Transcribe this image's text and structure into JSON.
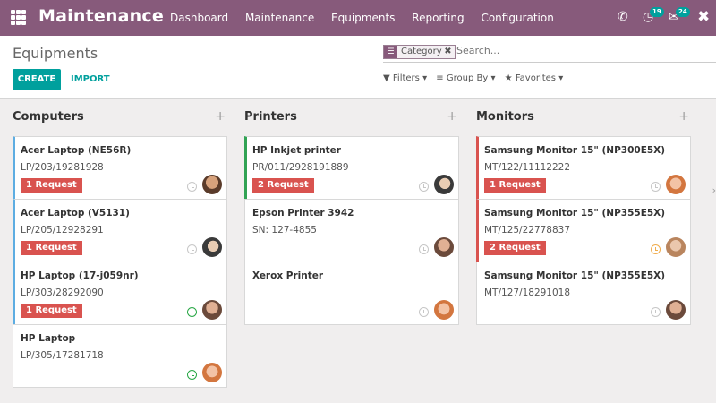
{
  "app": {
    "title": "Maintenance",
    "nav": [
      "Dashboard",
      "Maintenance",
      "Equipments",
      "Reporting",
      "Configuration"
    ],
    "icons": [
      "apps-grid-icon",
      "phone-icon",
      "activity-clock-icon",
      "discuss-chat-icon",
      "close-icon"
    ],
    "badges": {
      "activity": "19",
      "discuss": "24"
    },
    "colors": {
      "brand": "#875a7b",
      "accent": "#00a09d",
      "danger": "#d9534f"
    }
  },
  "control": {
    "breadcrumb": "Equipments",
    "create_label": "CREATE",
    "import_label": "IMPORT",
    "facet_label": "Category",
    "search_placeholder": "Search...",
    "filters_label": "Filters",
    "groupby_label": "Group By",
    "favorites_label": "Favorites"
  },
  "columns": [
    {
      "title": "Computers",
      "cards": [
        {
          "name": "Acer Laptop (NE56R)",
          "serial": "LP/203/19281928",
          "request": "1 Request",
          "activity": "gray",
          "stripe": "blue"
        },
        {
          "name": "Acer Laptop (V5131)",
          "serial": "LP/205/12928291",
          "request": "1 Request",
          "activity": "gray",
          "stripe": "blue"
        },
        {
          "name": "HP Laptop (17-j059nr)",
          "serial": "LP/303/28292090",
          "request": "1 Request",
          "activity": "green",
          "stripe": "blue"
        },
        {
          "name": "HP Laptop",
          "serial": "LP/305/17281718",
          "request": "",
          "activity": "green",
          "stripe": "none"
        }
      ]
    },
    {
      "title": "Printers",
      "cards": [
        {
          "name": "HP Inkjet printer",
          "serial": "PR/011/2928191889",
          "request": "2 Request",
          "activity": "gray",
          "stripe": "green"
        },
        {
          "name": "Epson Printer 3942",
          "serial": "SN: 127-4855",
          "request": "",
          "activity": "gray",
          "stripe": "none"
        },
        {
          "name": "Xerox Printer",
          "serial": "",
          "request": "",
          "activity": "gray",
          "stripe": "none"
        }
      ]
    },
    {
      "title": "Monitors",
      "cards": [
        {
          "name": "Samsung Monitor 15\" (NP300E5X)",
          "serial": "MT/122/11112222",
          "request": "1 Request",
          "activity": "gray",
          "stripe": "red"
        },
        {
          "name": "Samsung Monitor 15\" (NP355E5X)",
          "serial": "MT/125/22778837",
          "request": "2 Request",
          "activity": "orange",
          "stripe": "red"
        },
        {
          "name": "Samsung Monitor 15\" (NP355E5X)",
          "serial": "MT/127/18291018",
          "request": "",
          "activity": "gray",
          "stripe": "none"
        }
      ]
    }
  ]
}
